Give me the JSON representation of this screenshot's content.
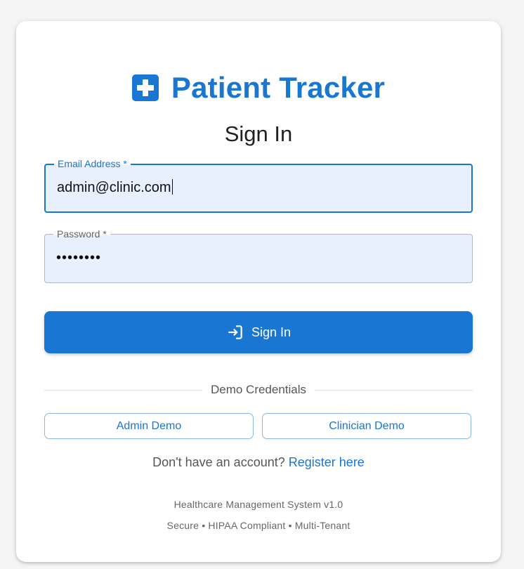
{
  "brand": {
    "title": "Patient Tracker",
    "icon": "medical-cross-icon",
    "color": "#1976d2"
  },
  "page_title": "Sign In",
  "form": {
    "email": {
      "label": "Email Address *",
      "value": "admin@clinic.com"
    },
    "password": {
      "label": "Password *",
      "value": "••••••••"
    },
    "submit_label": "Sign In",
    "submit_icon": "login-icon"
  },
  "demo": {
    "divider_label": "Demo Credentials",
    "admin_label": "Admin Demo",
    "clinician_label": "Clinician Demo"
  },
  "register": {
    "prompt": "Don't have an account?",
    "link_label": "Register here"
  },
  "footer": {
    "line1": "Healthcare Management System v1.0",
    "line2": "Secure • HIPAA Compliant • Multi-Tenant"
  },
  "colors": {
    "accent": "#1976d2",
    "field_background": "#e8f0fe",
    "page_background": "#f5f5f5"
  }
}
